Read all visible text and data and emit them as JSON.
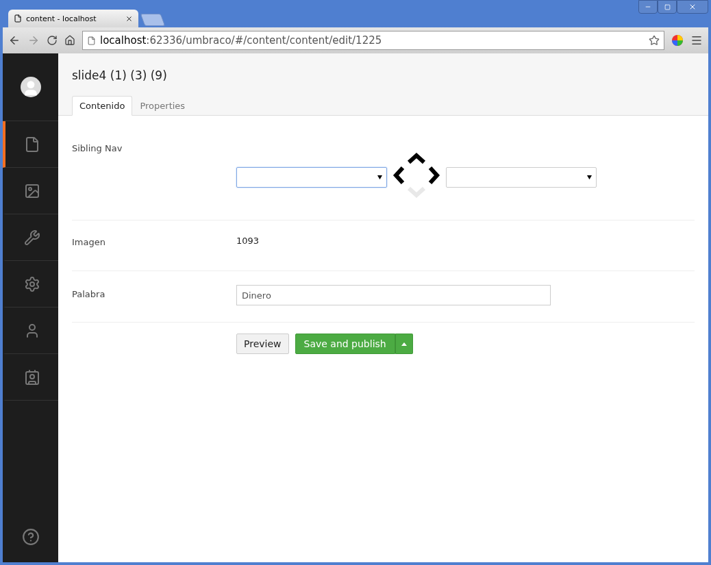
{
  "browser": {
    "tab_title": "content - localhost",
    "url_host": "localhost",
    "url_path": ":62336/umbraco/#/content/content/edit/1225"
  },
  "sidebar": {
    "items": [
      {
        "selected": true
      },
      {
        "selected": false
      },
      {
        "selected": false
      },
      {
        "selected": false
      },
      {
        "selected": false
      },
      {
        "selected": false
      }
    ]
  },
  "page": {
    "title": "slide4 (1) (3) (9)",
    "tabs": [
      {
        "label": "Contenido",
        "selected": true
      },
      {
        "label": "Properties",
        "selected": false
      }
    ],
    "sibling_nav": {
      "label": "Sibling Nav",
      "dropdowns": [
        {
          "focused": true
        },
        {
          "focused": false
        }
      ],
      "arrows": [
        {
          "kind": "up",
          "disabled": false
        },
        {
          "kind": "left",
          "disabled": false
        },
        {
          "kind": "right",
          "disabled": false
        },
        {
          "kind": "down",
          "disabled": true
        }
      ]
    },
    "imagen": {
      "label": "Imagen",
      "value": "1093"
    },
    "palabra": {
      "label": "Palabra",
      "value": "Dinero"
    },
    "buttons": {
      "preview": "Preview",
      "publish": "Save and publish"
    }
  }
}
